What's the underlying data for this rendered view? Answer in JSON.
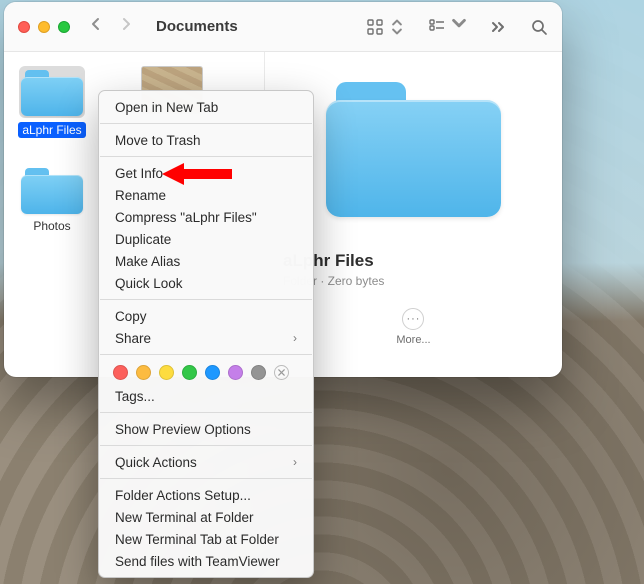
{
  "window": {
    "title": "Documents"
  },
  "items": [
    {
      "label": "aLphr Files",
      "selected": true,
      "kind": "folder"
    },
    {
      "label": "",
      "selected": false,
      "kind": "image"
    },
    {
      "label": "Photos",
      "selected": false,
      "kind": "folder"
    }
  ],
  "preview": {
    "name": "aLphr Files",
    "meta": "Folder · Zero bytes",
    "more_label": "More..."
  },
  "context_menu": {
    "open_new_tab": "Open in New Tab",
    "move_to_trash": "Move to Trash",
    "get_info": "Get Info",
    "rename": "Rename",
    "compress": "Compress \"aLphr Files\"",
    "duplicate": "Duplicate",
    "make_alias": "Make Alias",
    "quick_look": "Quick Look",
    "copy": "Copy",
    "share": "Share",
    "tags": "Tags...",
    "show_preview_options": "Show Preview Options",
    "quick_actions": "Quick Actions",
    "folder_actions_setup": "Folder Actions Setup...",
    "new_terminal_at_folder": "New Terminal at Folder",
    "new_terminal_tab_at_folder": "New Terminal Tab at Folder",
    "send_files_with_teamviewer": "Send files with TeamViewer"
  },
  "tag_colors": [
    "#fc605c",
    "#fcbb40",
    "#fddc3f",
    "#33c748",
    "#1e98ff",
    "#c47fe9",
    "#949494"
  ],
  "annotation": {
    "target": "get_info",
    "color": "#ff0000"
  }
}
